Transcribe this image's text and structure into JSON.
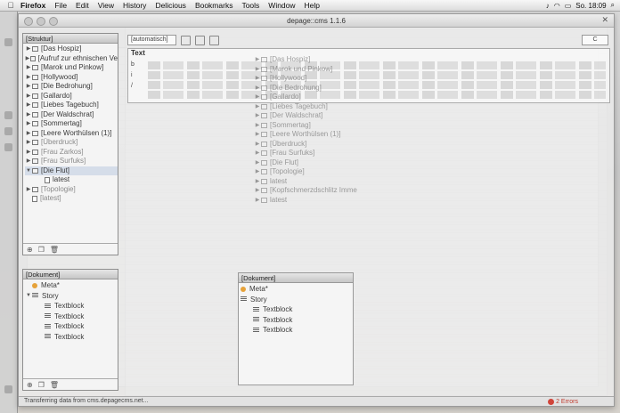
{
  "menubar": {
    "apple": "",
    "items": [
      "Firefox",
      "File",
      "Edit",
      "View",
      "History",
      "Delicious",
      "Bookmarks",
      "Tools",
      "Window",
      "Help"
    ],
    "clock": "So. 18:09"
  },
  "window": {
    "title": "depage::cms 1.1.6",
    "status": "Transferring data from cms.depagecms.net..."
  },
  "toolbar": {
    "style_select": "[automatisch]",
    "zoom_select": "C"
  },
  "editor": {
    "heading": "Text",
    "gutter": [
      "b",
      "i",
      "/"
    ]
  },
  "structure": {
    "title": "[Struktur]",
    "items": [
      {
        "label": "[Das Hospiz]",
        "kind": "folder"
      },
      {
        "label": "[Aufruf zur ethnischen Ve",
        "kind": "folder"
      },
      {
        "label": "[Marok und Pinkow]",
        "kind": "folder"
      },
      {
        "label": "[Hollywood]",
        "kind": "folder"
      },
      {
        "label": "[Die Bedrohung]",
        "kind": "folder"
      },
      {
        "label": "[Gallardo]",
        "kind": "folder"
      },
      {
        "label": "[Liebes Tagebuch]",
        "kind": "folder"
      },
      {
        "label": "[Der Waldschrat]",
        "kind": "folder"
      },
      {
        "label": "[Sommertag]",
        "kind": "folder"
      },
      {
        "label": "[Leere Worthülsen (1)]",
        "kind": "folder"
      },
      {
        "label": "[Überdruck]",
        "kind": "folder",
        "faded": true
      },
      {
        "label": "[Frau Zarkos]",
        "kind": "folder",
        "faded": true
      },
      {
        "label": "[Frau Surfuks]",
        "kind": "folder",
        "faded": true
      },
      {
        "label": "[Die Flut]",
        "kind": "folder-open"
      },
      {
        "label": "latest",
        "kind": "doc",
        "indent": true
      },
      {
        "label": "[Topologie]",
        "kind": "folder",
        "faded": true
      },
      {
        "label": "[latest]",
        "kind": "doc",
        "faded": true
      }
    ]
  },
  "document": {
    "title": "[Dokument]",
    "items": [
      {
        "label": "Meta*",
        "kind": "meta"
      },
      {
        "label": "Story",
        "kind": "story"
      },
      {
        "label": "Textblock",
        "kind": "block"
      },
      {
        "label": "Textblock",
        "kind": "block"
      },
      {
        "label": "Textblock",
        "kind": "block"
      },
      {
        "label": "Textblock",
        "kind": "block"
      }
    ]
  },
  "overlay": {
    "items": [
      "[Das Hospiz]",
      "[Marok und Pinkow]",
      "[Hollywood]",
      "[Die Bedrohung]",
      "[Gallardo]",
      "[Liebes Tagebuch]",
      "[Der Waldschrat]",
      "[Sommertag]",
      "[Leere Worthülsen (1)]",
      "[Überdruck]",
      "[Frau Surfuks]",
      "[Die Flut]",
      "[Topologie]",
      "latest",
      "[Kopfschmerzdschlitz Imme",
      "latest"
    ],
    "doc_title": "[Dokument]",
    "doc_items": [
      "Meta*",
      "Story",
      "Textblock",
      "Textblock",
      "Textblock"
    ]
  },
  "errors": {
    "label": "2 Errors"
  }
}
